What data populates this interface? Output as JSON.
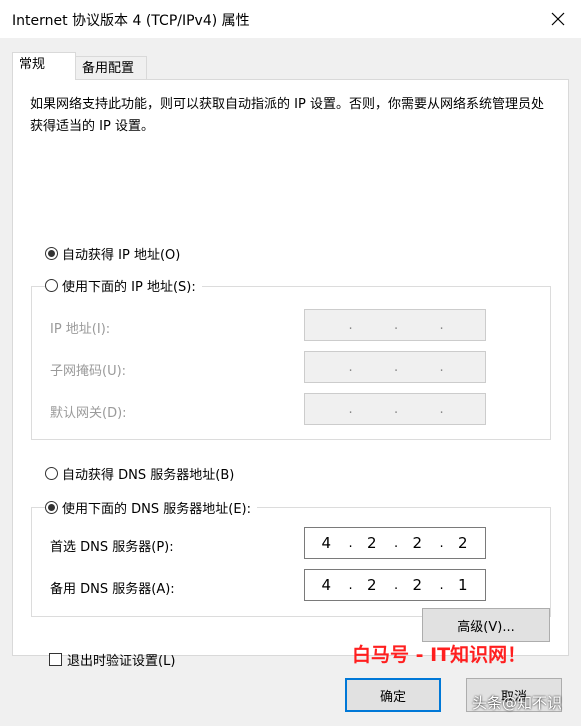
{
  "window": {
    "title": "Internet 协议版本 4 (TCP/IPv4) 属性"
  },
  "tabs": [
    "常规",
    "备用配置"
  ],
  "general": {
    "description": "如果网络支持此功能，则可以获取自动指派的 IP 设置。否则，你需要从网络系统管理员处获得适当的 IP 设置。",
    "ip_auto_label": "自动获得 IP 地址(O)",
    "ip_manual_label": "使用下面的 IP 地址(S):",
    "ip_fields": [
      {
        "label": "IP 地址(I):",
        "octets": [
          "",
          "",
          "",
          ""
        ]
      },
      {
        "label": "子网掩码(U):",
        "octets": [
          "",
          "",
          "",
          ""
        ]
      },
      {
        "label": "默认网关(D):",
        "octets": [
          "",
          "",
          "",
          ""
        ]
      }
    ],
    "dns_auto_label": "自动获得 DNS 服务器地址(B)",
    "dns_manual_label": "使用下面的 DNS 服务器地址(E):",
    "dns_fields": [
      {
        "label": "首选 DNS 服务器(P):",
        "octets": [
          "4",
          "2",
          "2",
          "2"
        ]
      },
      {
        "label": "备用 DNS 服务器(A):",
        "octets": [
          "4",
          "2",
          "2",
          "1"
        ]
      }
    ],
    "validate_label": "退出时验证设置(L)",
    "validate_checked": false,
    "advanced_label": "高级(V)...",
    "ip_mode": "auto",
    "dns_mode": "manual"
  },
  "buttons": {
    "ok": "确定",
    "cancel": "取消"
  },
  "watermark": {
    "main": "白马号 - IT知识网！",
    "sub": "头条@知不识"
  }
}
